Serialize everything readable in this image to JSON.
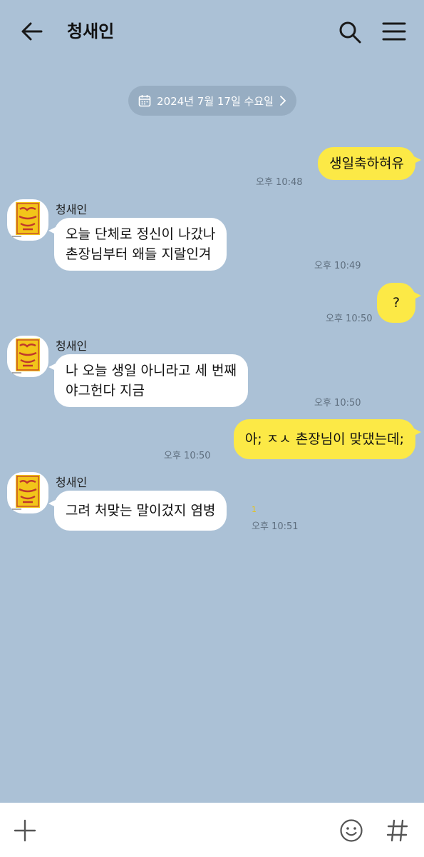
{
  "header": {
    "title": "청새인"
  },
  "date_divider": {
    "label": "2024년 7월 17일 수요일"
  },
  "messages": [
    {
      "side": "me",
      "text": "생일축하혀유",
      "time": "오후 10:48"
    },
    {
      "side": "other",
      "sender": "청새인",
      "lines": [
        "오늘 단체로 정신이 나갔나",
        "촌장님부터 왜들 지랄인겨"
      ],
      "time": "오후 10:49"
    },
    {
      "side": "me",
      "text": "?",
      "time": "오후 10:50"
    },
    {
      "side": "other",
      "sender": "청새인",
      "lines": [
        "나 오늘 생일 아니라고 세 번째",
        "야그헌다 지금"
      ],
      "time": "오후 10:50"
    },
    {
      "side": "me",
      "text": "아; ㅈㅅ 촌장님이 맞댔는데;",
      "time": "오후 10:50"
    },
    {
      "side": "other",
      "sender": "청새인",
      "lines": [
        "그려 처맞는 말이겄지 염병"
      ],
      "time": "오후 10:51",
      "unread": "1"
    }
  ],
  "icons": {
    "back": "arrow-left-icon",
    "search": "search-icon",
    "menu": "hamburger-menu-icon",
    "calendar": "calendar-icon",
    "chevron": "chevron-right-icon",
    "add": "plus-icon",
    "emoji": "smiley-icon",
    "hashtag": "hashtag-icon"
  },
  "colors": {
    "background": "#abc1d6",
    "my_bubble": "#fce946",
    "other_bubble": "#ffffff",
    "date_pill": "#97adc2"
  }
}
